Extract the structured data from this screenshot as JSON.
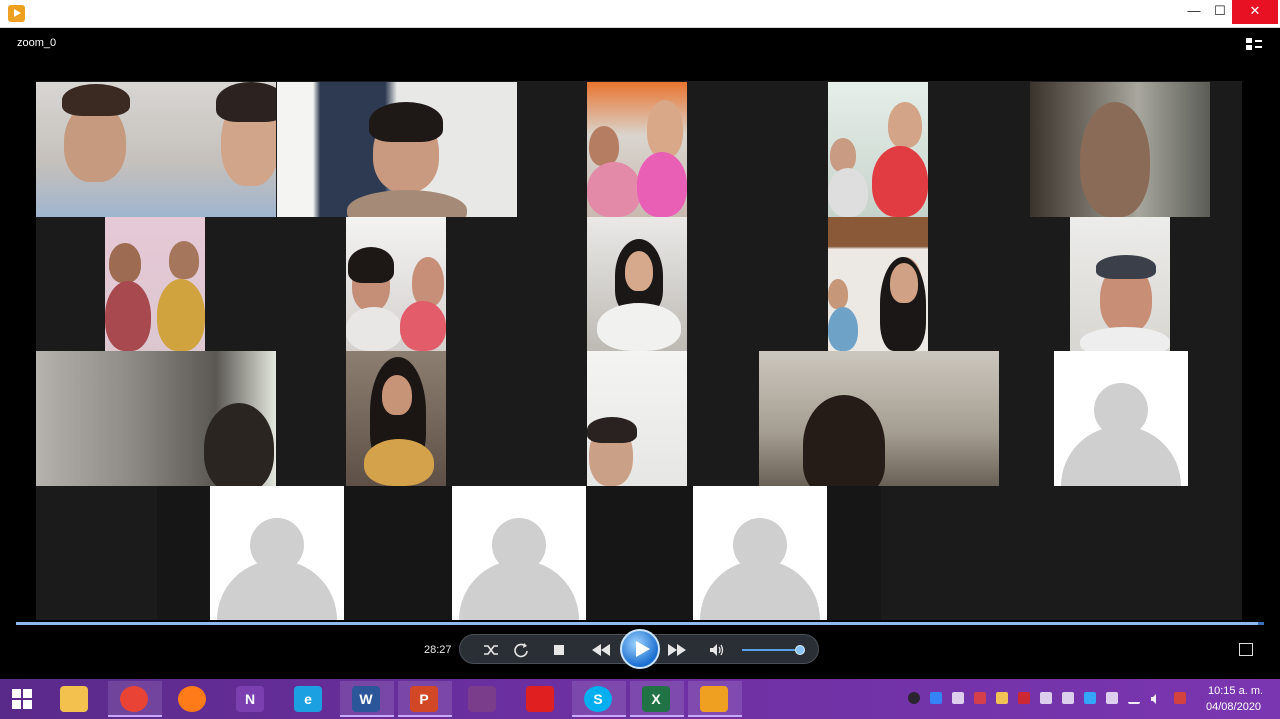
{
  "window": {
    "controls": {
      "minimize": "—",
      "maximize": "☐",
      "close": "✕"
    }
  },
  "player": {
    "file_title": "zoom_0",
    "time_elapsed": "28:27",
    "seek_progress": 0.995,
    "volume_level": 0.93,
    "state": "paused",
    "icons": [
      "switch-to-library-icon",
      "shuffle-icon",
      "repeat-icon",
      "stop-icon",
      "previous-icon",
      "play-icon",
      "next-icon",
      "volume-icon",
      "fullscreen-icon"
    ]
  },
  "gallery": {
    "participant_count": 18,
    "video_participants": 14,
    "avatar_participants": 4
  },
  "taskbar": {
    "apps": [
      {
        "name": "file-explorer",
        "glyph": ""
      },
      {
        "name": "chrome",
        "glyph": ""
      },
      {
        "name": "firefox",
        "glyph": ""
      },
      {
        "name": "onenote",
        "glyph": "N"
      },
      {
        "name": "internet-explorer",
        "glyph": "e"
      },
      {
        "name": "word",
        "glyph": "W"
      },
      {
        "name": "powerpoint",
        "glyph": "P"
      },
      {
        "name": "winrar",
        "glyph": ""
      },
      {
        "name": "acrobat",
        "glyph": ""
      },
      {
        "name": "skype",
        "glyph": "S"
      },
      {
        "name": "excel",
        "glyph": "X"
      },
      {
        "name": "media-player",
        "glyph": ""
      }
    ],
    "clock": {
      "time": "10:15 a. m.",
      "date": "04/08/2020"
    }
  }
}
